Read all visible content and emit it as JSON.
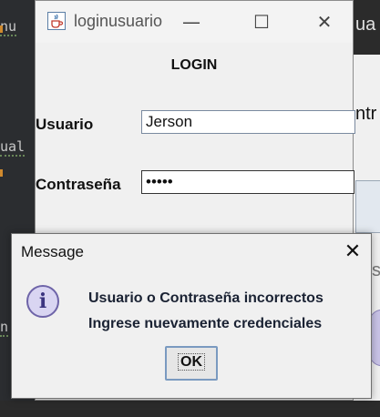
{
  "background_ide": {
    "left_fragments": [
      "nu",
      "ual",
      "n"
    ],
    "right_fragments": [
      "ua",
      "ntr",
      "s"
    ]
  },
  "login_window": {
    "title": "loginusuario",
    "heading": "LOGIN",
    "usuario_label": "Usuario",
    "usuario_value": "Jerson",
    "password_label": "Contraseña",
    "password_masked": "•••••",
    "controls": {
      "minimize": "—",
      "maximize": "☐",
      "close": "✕"
    }
  },
  "dialog": {
    "title": "Message",
    "close": "✕",
    "icon": "info-icon",
    "icon_glyph": "i",
    "line1": "Usuario o Contraseña incorrectos",
    "line2": "Ingrese nuevamente credenciales",
    "ok_label": "OK"
  },
  "colors": {
    "ide_background": "#2b2b2b",
    "window_background": "#f0f0f0",
    "button_border": "#7a9ac0",
    "info_icon_fill": "#d9d5f2"
  }
}
